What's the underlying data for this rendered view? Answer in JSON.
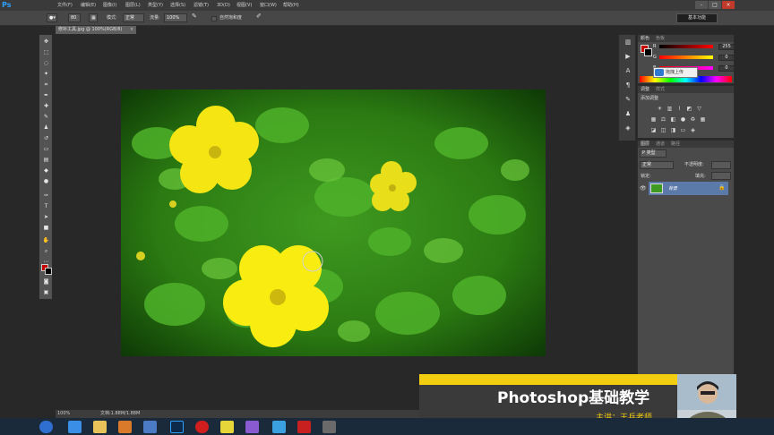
{
  "app": {
    "logo": "Ps",
    "menus": [
      "文件(F)",
      "编辑(E)",
      "图像(I)",
      "图层(L)",
      "类型(Y)",
      "选择(S)",
      "滤镜(T)",
      "3D(D)",
      "视图(V)",
      "窗口(W)",
      "帮助(H)"
    ],
    "window_buttons": [
      "-",
      "□",
      "×"
    ]
  },
  "options": {
    "brush_size": "80",
    "mode_label": "模式:",
    "mode_value": "正常",
    "flow_label": "流量:",
    "flow_value": "100%",
    "auto_fill_label": "自然饱和度",
    "workspace": "基本功能"
  },
  "document": {
    "tab_title": "修补工具.jpg @ 100%(RGB/8)",
    "close": "×",
    "zoom": "100%",
    "doc_info": "文档:1.88M/1.88M"
  },
  "panels": {
    "color_tabs": [
      "颜色",
      "色板"
    ],
    "channels": [
      {
        "label": "R",
        "value": "255"
      },
      {
        "label": "G",
        "value": "0"
      },
      {
        "label": "B",
        "value": "0"
      }
    ],
    "tooltip": "拖拽上传",
    "adjust_tabs": [
      "调整",
      "样式"
    ],
    "adjust_title": "添加调整",
    "layers_tabs": [
      "图层",
      "通道",
      "路径"
    ],
    "layer_kind": "P 类型",
    "blend_mode": "正常",
    "opacity_label": "不透明度:",
    "lock_label": "锁定:",
    "fill_label": "填充:",
    "layer_name": "背景"
  },
  "banner": {
    "title": "Photoshop基础教学",
    "subtitle": "主讲：王兵老师"
  },
  "colors": {
    "accent_yellow": "#f3ce10",
    "foreground": "#c40000",
    "ps_blue": "#2ea0ff"
  }
}
